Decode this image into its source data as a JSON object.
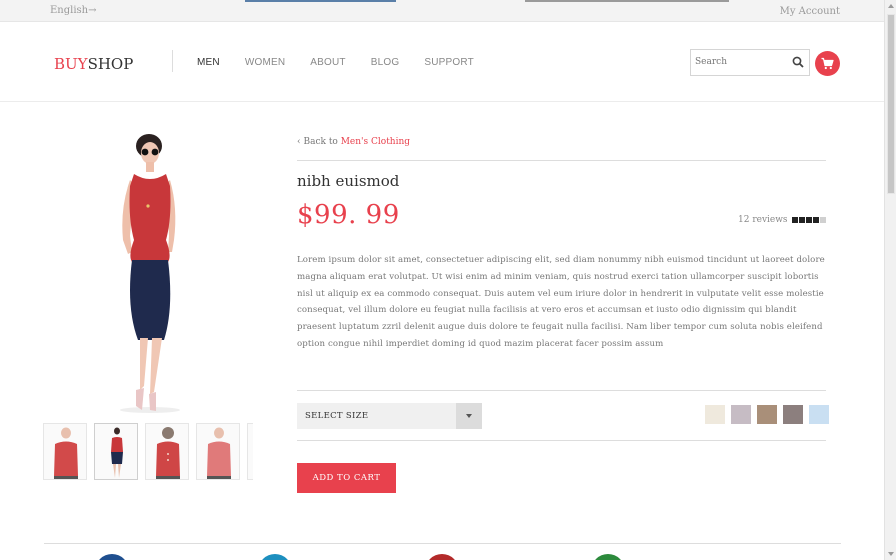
{
  "topbar": {
    "language": "English→",
    "account": "My Account"
  },
  "header": {
    "logo_buy": "BUY",
    "logo_shop": "SHOP",
    "nav": [
      "MEN",
      "WOMEN",
      "ABOUT",
      "BLOG",
      "SUPPORT"
    ],
    "active_nav": "MEN",
    "search_placeholder": "Search"
  },
  "product": {
    "back_prefix": "Back to ",
    "back_link": "Men's Clothing",
    "title": "nibh euismod",
    "price": "$99. 99",
    "reviews": "12 reviews",
    "rating": 4,
    "rating_max": 5,
    "description": "Lorem ipsum dolor sit amet, consectetuer adipiscing elit, sed diam nonummy nibh euismod tincidunt ut laoreet dolore magna aliquam erat volutpat. Ut wisi enim ad minim veniam, quis nostrud exerci tation ullamcorper suscipit lobortis nisl ut aliquip ex ea commodo consequat. Duis autem vel eum iriure dolor in hendrerit in vulputate velit esse molestie consequat, vel illum dolore eu feugiat nulla facilisis at vero eros et accumsan et iusto odio dignissim qui blandit praesent luptatum zzril delenit augue duis dolore te feugait nulla facilisi. Nam liber tempor cum soluta nobis eleifend option congue nihil imperdiet doming id quod mazim placerat facer possim assum",
    "size_label": "SELECT SIZE",
    "swatch_colors": [
      "#efe9dd",
      "#c6bcc4",
      "#a98f79",
      "#8c7f7e",
      "#c9dff2"
    ],
    "add_to_cart": "ADD TO CART"
  },
  "colors": {
    "accent": "#e8414d",
    "dress_red": "#c8373a",
    "skirt_navy": "#1f2a4d"
  },
  "footer_circle_colors": [
    "#1f4f8f",
    "#1d8fbf",
    "#b32a2a",
    "#2c8a3c"
  ]
}
